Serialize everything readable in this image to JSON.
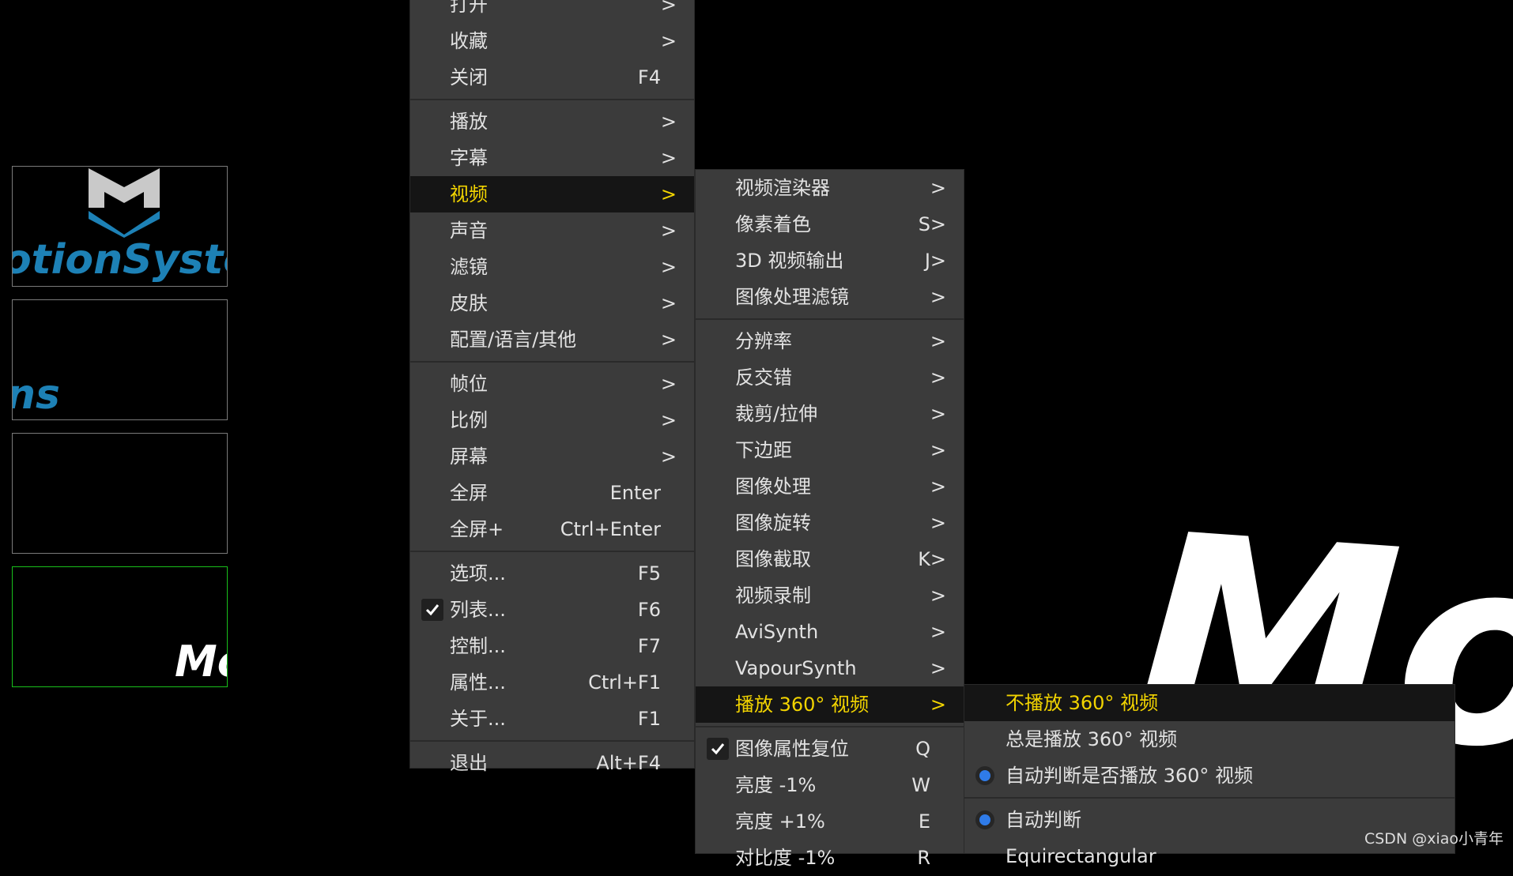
{
  "thumbnails": [
    {
      "text": "otionSyster"
    },
    {
      "text": "ns"
    },
    {
      "text": ""
    },
    {
      "text": "Mo"
    }
  ],
  "background_big_text": "Mo",
  "menu_main": [
    {
      "label": "打开",
      "shortcut": "",
      "arrow": ">"
    },
    {
      "label": "收藏",
      "shortcut": "",
      "arrow": ">"
    },
    {
      "label": "关闭",
      "shortcut": "F4",
      "arrow": ""
    },
    {
      "label": "播放",
      "shortcut": "",
      "arrow": ">"
    },
    {
      "label": "字幕",
      "shortcut": "",
      "arrow": ">"
    },
    {
      "label": "视频",
      "shortcut": "",
      "arrow": ">"
    },
    {
      "label": "声音",
      "shortcut": "",
      "arrow": ">"
    },
    {
      "label": "滤镜",
      "shortcut": "",
      "arrow": ">"
    },
    {
      "label": "皮肤",
      "shortcut": "",
      "arrow": ">"
    },
    {
      "label": "配置/语言/其他",
      "shortcut": "",
      "arrow": ">"
    },
    {
      "label": "帧位",
      "shortcut": "",
      "arrow": ">"
    },
    {
      "label": "比例",
      "shortcut": "",
      "arrow": ">"
    },
    {
      "label": "屏幕",
      "shortcut": "",
      "arrow": ">"
    },
    {
      "label": "全屏",
      "shortcut": "Enter",
      "arrow": ""
    },
    {
      "label": "全屏+",
      "shortcut": "Ctrl+Enter",
      "arrow": ""
    },
    {
      "label": "选项...",
      "shortcut": "F5",
      "arrow": ""
    },
    {
      "label": "列表...",
      "shortcut": "F6",
      "arrow": "",
      "checked": true
    },
    {
      "label": "控制...",
      "shortcut": "F7",
      "arrow": ""
    },
    {
      "label": "属性...",
      "shortcut": "Ctrl+F1",
      "arrow": ""
    },
    {
      "label": "关于...",
      "shortcut": "F1",
      "arrow": ""
    },
    {
      "label": "退出",
      "shortcut": "Alt+F4",
      "arrow": ""
    }
  ],
  "menu_video": [
    {
      "label": "视频渲染器",
      "shortcut": "",
      "arrow": ">"
    },
    {
      "label": "像素着色",
      "shortcut": "S",
      "arrow": ">"
    },
    {
      "label": "3D 视频输出",
      "shortcut": "J",
      "arrow": ">"
    },
    {
      "label": "图像处理滤镜",
      "shortcut": "",
      "arrow": ">"
    },
    {
      "label": "分辨率",
      "shortcut": "",
      "arrow": ">"
    },
    {
      "label": "反交错",
      "shortcut": "",
      "arrow": ">"
    },
    {
      "label": "裁剪/拉伸",
      "shortcut": "",
      "arrow": ">"
    },
    {
      "label": "下边距",
      "shortcut": "",
      "arrow": ">"
    },
    {
      "label": "图像处理",
      "shortcut": "",
      "arrow": ">"
    },
    {
      "label": "图像旋转",
      "shortcut": "",
      "arrow": ">"
    },
    {
      "label": "图像截取",
      "shortcut": "K",
      "arrow": ">"
    },
    {
      "label": "视频录制",
      "shortcut": "",
      "arrow": ">"
    },
    {
      "label": "AviSynth",
      "shortcut": "",
      "arrow": ">"
    },
    {
      "label": "VapourSynth",
      "shortcut": "",
      "arrow": ">"
    },
    {
      "label": "播放 360° 视频",
      "shortcut": "",
      "arrow": ">"
    },
    {
      "label": "图像属性复位",
      "shortcut": "Q",
      "arrow": "",
      "checked": true
    },
    {
      "label": "亮度 -1%",
      "shortcut": "W",
      "arrow": ""
    },
    {
      "label": "亮度 +1%",
      "shortcut": "E",
      "arrow": ""
    },
    {
      "label": "对比度 -1%",
      "shortcut": "R",
      "arrow": ""
    }
  ],
  "menu_360": [
    {
      "label": "不播放 360° 视频"
    },
    {
      "label": "总是播放 360° 视频"
    },
    {
      "label": "自动判断是否播放 360° 视频",
      "radio": true
    },
    {
      "label": "自动判断",
      "radio": true
    },
    {
      "label": "Equirectangular"
    }
  ],
  "watermark": "CSDN @xiao小青年",
  "colors": {
    "menu_bg": "#3b3b3b",
    "selected_bg": "#151515",
    "selected_text": "#f2d400",
    "radio_dot": "#2f7be8",
    "logo_blue": "#1d81b6",
    "active_border": "#19c01b"
  }
}
